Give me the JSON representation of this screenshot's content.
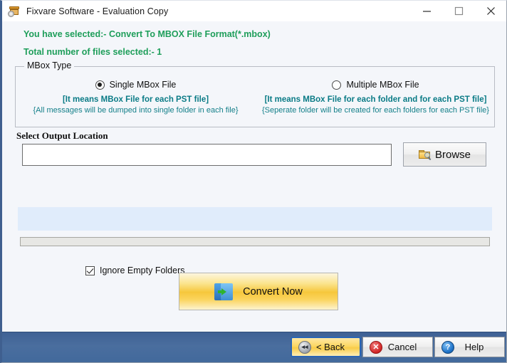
{
  "window": {
    "title": "Fixvare Software - Evaluation Copy",
    "icon": "archive-box-icon",
    "controls": {
      "minimize": "minimize-icon",
      "maximize": "maximize-icon",
      "close": "close-icon"
    }
  },
  "status": {
    "line1": "You have selected:- Convert To MBOX File Format(*.mbox)",
    "line2": "Total number of files selected:- 1",
    "color": "#1e9e5a"
  },
  "mbox_type": {
    "legend": "MBox Type",
    "options": [
      {
        "label": "Single MBox File",
        "selected": true,
        "hint_bold": "[It means MBox File for each PST file]",
        "hint_sub": "{All messages will be dumped into single folder in each file}"
      },
      {
        "label": "Multiple MBox File",
        "selected": false,
        "hint_bold": "[It means MBox File for each folder and for each PST file]",
        "hint_sub": "{Seperate folder will be created for each folders for each PST file}"
      }
    ],
    "hint_color": "#0a7b86"
  },
  "output": {
    "label": "Select Output Location",
    "path_value": "",
    "path_placeholder": "",
    "browse_label": "Browse",
    "browse_icon": "folder-search-icon"
  },
  "progress": {
    "percent": 0,
    "fill_color": "#06b025",
    "track_color": "#e7e7e4"
  },
  "actions": {
    "ignore_empty_label": "Ignore Empty Folders",
    "ignore_empty_checked": true,
    "convert_label": "Convert Now",
    "convert_icon": "convert-arrow-icon"
  },
  "footer": {
    "buttons": [
      {
        "label": "< Back",
        "icon": "rewind-icon",
        "glyph": "◀◀",
        "primary": true
      },
      {
        "label": "Cancel",
        "icon": "cancel-icon",
        "glyph": "✕",
        "primary": false
      },
      {
        "label": "Help",
        "icon": "help-icon",
        "glyph": "?",
        "primary": false
      }
    ],
    "background": "#44689b"
  }
}
